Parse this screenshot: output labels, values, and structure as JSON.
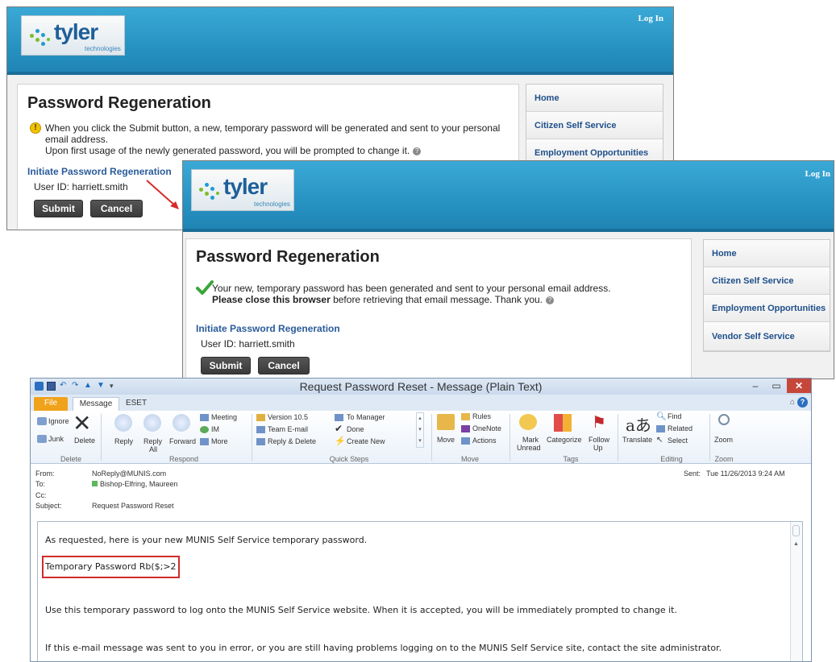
{
  "portal_before": {
    "logo_word": "tyler",
    "logo_sub": "technologies",
    "login": "Log In",
    "title": "Password Regeneration",
    "message_line1": "When you click the Submit button, a new, temporary password will be generated and sent to your personal email address.",
    "message_line2": "Upon first usage of the newly generated password, you will be prompted to change it.",
    "section": "Initiate Password Regeneration",
    "user_id": "User ID: harriett.smith",
    "submit": "Submit",
    "cancel": "Cancel",
    "nav": [
      "Home",
      "Citizen Self Service",
      "Employment Opportunities"
    ]
  },
  "portal_after": {
    "logo_word": "tyler",
    "logo_sub": "technologies",
    "login": "Log In",
    "title": "Password Regeneration",
    "message_line1": "Your new, temporary password has been generated and sent to your personal email address.",
    "message_bold": "Please close this browser",
    "message_line2_rest": " before retrieving that email message. Thank you.",
    "section": "Initiate Password Regeneration",
    "user_id": "User ID: harriett.smith",
    "submit": "Submit",
    "cancel": "Cancel",
    "nav": [
      "Home",
      "Citizen Self Service",
      "Employment Opportunities",
      "Vendor Self Service"
    ]
  },
  "outlook": {
    "title": "Request Password Reset - Message (Plain Text)",
    "tabs": {
      "file": "File",
      "message": "Message",
      "eset": "ESET"
    },
    "ribbon": {
      "ignore": "Ignore",
      "junk": "Junk",
      "delete": "Delete",
      "reply": "Reply",
      "reply_all_1": "Reply",
      "reply_all_2": "All",
      "forward": "Forward",
      "meeting": "Meeting",
      "im": "IM",
      "more": "More",
      "qs1": "Version 10.5",
      "qs2": "Team E-mail",
      "qs3": "Reply & Delete",
      "qs4": "To Manager",
      "qs5": "Done",
      "qs6": "Create New",
      "move": "Move",
      "rules": "Rules",
      "onenote": "OneNote",
      "actions": "Actions",
      "mark_unread_1": "Mark",
      "mark_unread_2": "Unread",
      "categorize": "Categorize",
      "follow_up_1": "Follow",
      "follow_up_2": "Up",
      "translate": "Translate",
      "find": "Find",
      "related": "Related",
      "select": "Select",
      "zoom": "Zoom",
      "groups": [
        "Delete",
        "Respond",
        "Quick Steps",
        "Move",
        "Tags",
        "Editing",
        "Zoom"
      ]
    },
    "header": {
      "from_label": "From:",
      "from": "NoReply@MUNIS.com",
      "to_label": "To:",
      "to": "Bishop-Elfring, Maureen",
      "cc_label": "Cc:",
      "subject_label": "Subject:",
      "subject": "Request Password Reset",
      "sent_label": "Sent:",
      "sent": "Tue 11/26/2013 9:24 AM"
    },
    "body": {
      "line1": "As requested, here is your new MUNIS Self Service temporary password.",
      "temp": "Temporary Password  Rb($;>2",
      "line3": "Use this temporary password to log onto the MUNIS Self Service website. When it is accepted, you will be immediately prompted to change it.",
      "line4": "If this e-mail message was sent to you in error, or you are still having problems logging on to the MUNIS Self Service site, contact the site administrator."
    }
  }
}
